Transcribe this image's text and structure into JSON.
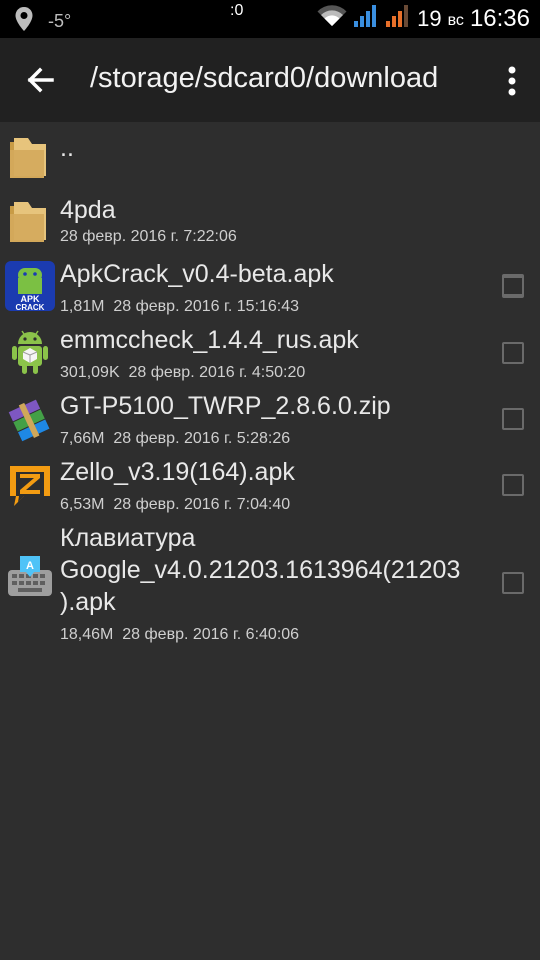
{
  "status_bar": {
    "temperature": "-5°",
    "center_text": ":0",
    "day": "19",
    "weekday": "вс",
    "time": "16:36"
  },
  "action_bar": {
    "title": "/storage/sdcard0/download"
  },
  "files": [
    {
      "name": "..",
      "size": "",
      "date": "",
      "icon": "folder-icon",
      "checkbox": false
    },
    {
      "name": "4pda",
      "size": "",
      "date": "28 февр. 2016 г. 7:22:06",
      "icon": "folder-icon",
      "checkbox": true
    },
    {
      "name": "ApkCrack_v0.4-beta.apk",
      "size": "1,81M",
      "date": "28 февр. 2016 г. 15:16:43",
      "icon": "apkcrack-app-icon",
      "icon_text": "APK CRACK",
      "checkbox": true
    },
    {
      "name": "emmccheck_1.4.4_rus.apk",
      "size": "301,09K",
      "date": "28 февр. 2016 г. 4:50:20",
      "icon": "android-robot-icon",
      "checkbox": true
    },
    {
      "name": "GT-P5100_TWRP_2.8.6.0.zip",
      "size": "7,66M",
      "date": "28 февр. 2016 г. 5:28:26",
      "icon": "winrar-archive-icon",
      "checkbox": true
    },
    {
      "name": "Zello_v3.19(164).apk",
      "size": "6,53M",
      "date": "28 февр. 2016 г. 7:04:40",
      "icon": "zello-app-icon",
      "checkbox": true
    },
    {
      "name_lines": [
        "Клавиатура",
        "Google_v4.0.21203.1613964(21203",
        ").apk"
      ],
      "size": "18,46M",
      "date": "28 февр. 2016 г. 6:40:06",
      "icon": "google-keyboard-icon",
      "icon_text": "A",
      "checkbox": true
    }
  ]
}
